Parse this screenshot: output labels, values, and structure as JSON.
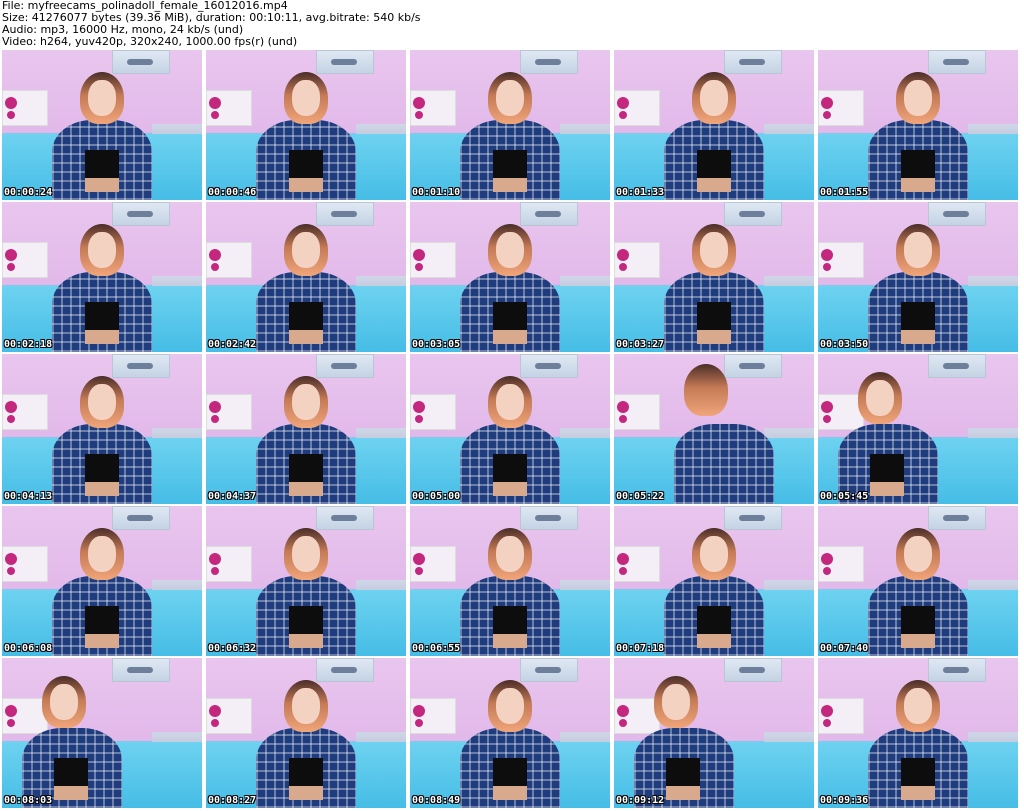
{
  "header": {
    "file": "File: myfreecams_polinadoll_female_16012016.mp4",
    "size": "Size: 41276077 bytes (39.36 MiB), duration: 00:10:11, avg.bitrate: 540 kb/s",
    "audio": "Audio: mp3, 16000 Hz, mono, 24 kb/s (und)",
    "video": "Video: h264, yuv420p, 320x240, 1000.00 fps(r) (und)"
  },
  "thumbnails": [
    {
      "timestamp": "00:00:24",
      "pose": "center"
    },
    {
      "timestamp": "00:00:46",
      "pose": "center"
    },
    {
      "timestamp": "00:01:10",
      "pose": "center"
    },
    {
      "timestamp": "00:01:33",
      "pose": "center"
    },
    {
      "timestamp": "00:01:55",
      "pose": "center"
    },
    {
      "timestamp": "00:02:18",
      "pose": "center"
    },
    {
      "timestamp": "00:02:42",
      "pose": "center"
    },
    {
      "timestamp": "00:03:05",
      "pose": "center"
    },
    {
      "timestamp": "00:03:27",
      "pose": "center"
    },
    {
      "timestamp": "00:03:50",
      "pose": "center"
    },
    {
      "timestamp": "00:04:13",
      "pose": "center"
    },
    {
      "timestamp": "00:04:37",
      "pose": "center"
    },
    {
      "timestamp": "00:05:00",
      "pose": "center"
    },
    {
      "timestamp": "00:05:22",
      "pose": "back"
    },
    {
      "timestamp": "00:05:45",
      "pose": "left"
    },
    {
      "timestamp": "00:06:08",
      "pose": "center"
    },
    {
      "timestamp": "00:06:32",
      "pose": "center"
    },
    {
      "timestamp": "00:06:55",
      "pose": "center"
    },
    {
      "timestamp": "00:07:18",
      "pose": "center"
    },
    {
      "timestamp": "00:07:40",
      "pose": "center"
    },
    {
      "timestamp": "00:08:03",
      "pose": "left"
    },
    {
      "timestamp": "00:08:27",
      "pose": "center"
    },
    {
      "timestamp": "00:08:49",
      "pose": "center"
    },
    {
      "timestamp": "00:09:12",
      "pose": "left"
    },
    {
      "timestamp": "00:09:36",
      "pose": "center"
    }
  ]
}
